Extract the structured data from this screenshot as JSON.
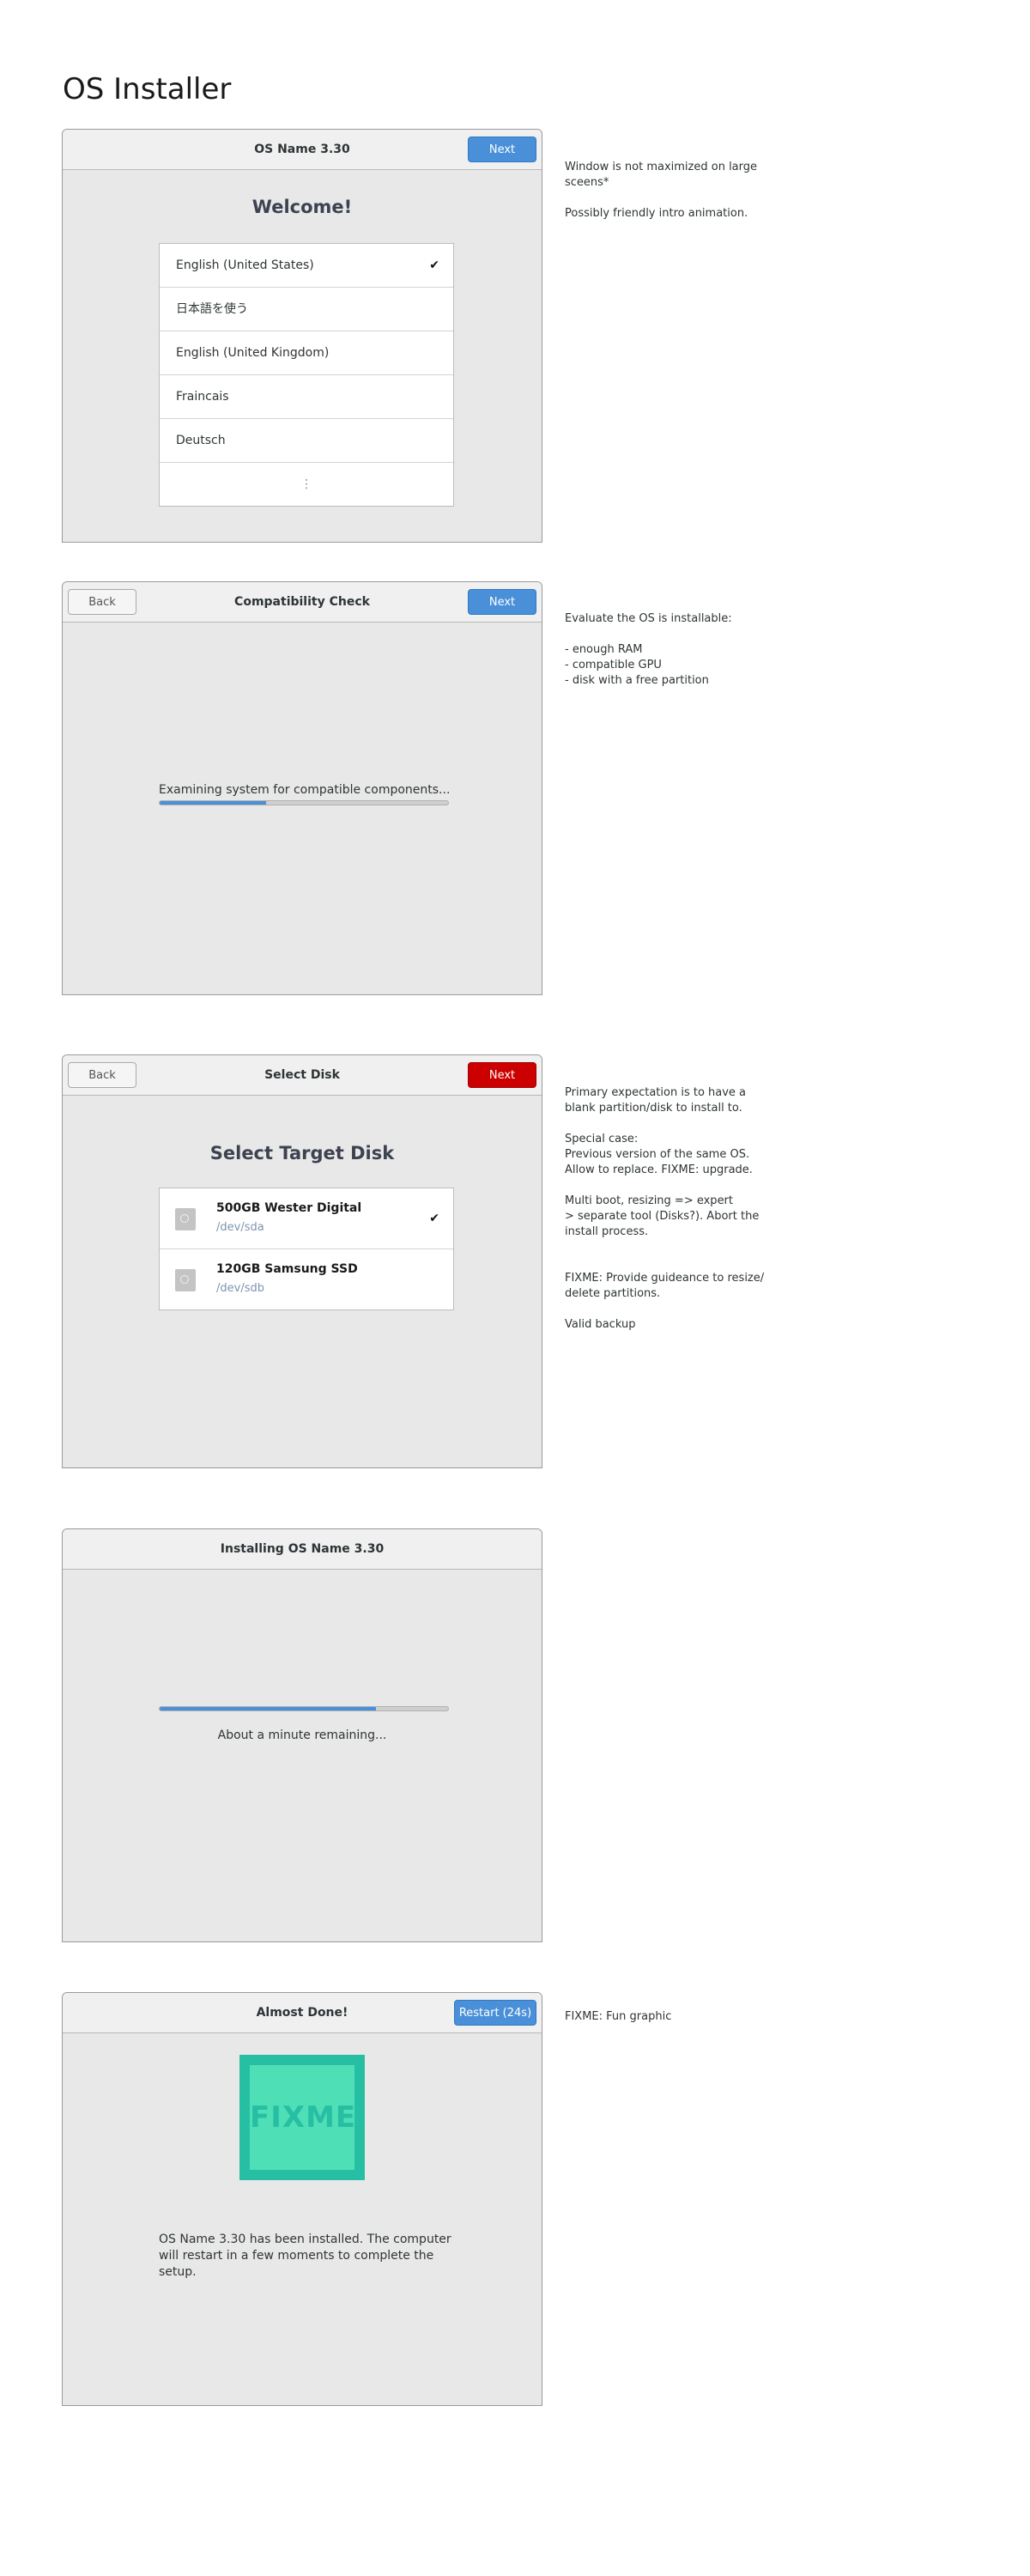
{
  "page": {
    "title": "OS Installer"
  },
  "screens": {
    "welcome": {
      "header_title": "OS Name 3.30",
      "next_label": "Next",
      "heading": "Welcome!",
      "languages": [
        "English (United States)",
        "日本語を使う",
        "English (United Kingdom)",
        "Fraincais",
        "Deutsch"
      ],
      "selected_mark": "✔",
      "more_mark": "⋮",
      "note": "Window is not maximized on large sceens*\n\nPossibly friendly intro animation."
    },
    "compat": {
      "header_title": "Compatibility Check",
      "back_label": "Back",
      "next_label": "Next",
      "status": "Examining system for compatible components...",
      "progress": 0.37,
      "note": "Evaluate the OS is installable:\n\n- enough RAM\n- compatible GPU\n- disk with a free partition"
    },
    "disk": {
      "header_title": "Select Disk",
      "back_label": "Back",
      "next_label": "Next",
      "heading": "Select Target Disk",
      "disks": [
        {
          "name": "500GB Wester Digital",
          "path": "/dev/sda"
        },
        {
          "name": "120GB Samsung SSD",
          "path": "/dev/sdb"
        }
      ],
      "selected_mark": "✔",
      "note": "Primary expectation is to have a blank partition/disk to install to.\n\nSpecial case:\nPrevious version of the same OS.\nAllow to replace. FIXME: upgrade.\n\nMulti boot, resizing => expert\n> separate tool (Disks?). Abort the install process.\n\n\nFIXME: Provide guideance to resize/ delete partitions.\n\nValid backup"
    },
    "install": {
      "header_title": "Installing OS Name 3.30",
      "progress": 0.75,
      "status": "About a minute remaining..."
    },
    "done": {
      "header_title": "Almost Done!",
      "restart_label": "Restart (24s)",
      "graphic_text": "FIXME",
      "message": "OS Name 3.30 has been installed. The computer will restart in a few moments to complete the setup.",
      "note": "FIXME: Fun graphic"
    }
  },
  "colors": {
    "accent": "#4a90d9",
    "danger": "#cc0000",
    "graphic": "#27bfa4"
  }
}
